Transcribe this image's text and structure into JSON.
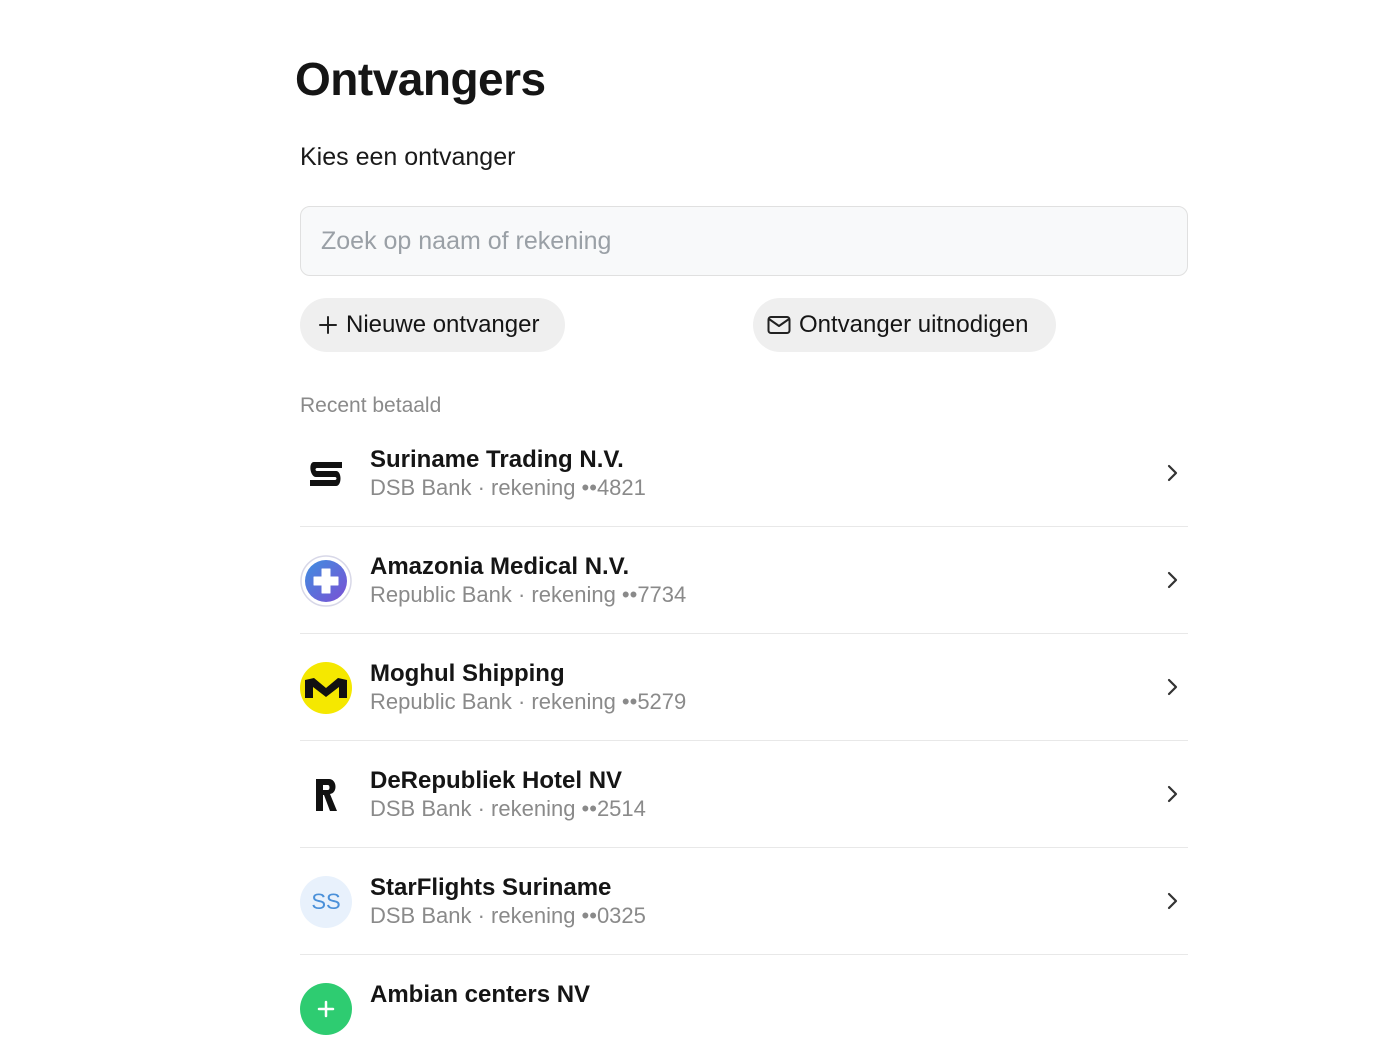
{
  "page": {
    "title": "Ontvangers",
    "subtitle": "Kies een ontvanger"
  },
  "search": {
    "placeholder": "Zoek op naam of rekening",
    "value": ""
  },
  "actions": {
    "new_label": "Nieuwe ontvanger",
    "new_icon": "plus-icon",
    "invite_label": "Ontvanger uitnodigen",
    "invite_icon": "mail-icon"
  },
  "recent": {
    "label": "Recent betaald",
    "items": [
      {
        "name": "Suriname Trading N.V.",
        "meta": "DSB Bank · rekening ••4821",
        "avatar": "s-logo-icon"
      },
      {
        "name": "Amazonia Medical N.V.",
        "meta": "Republic Bank · rekening ••7734",
        "avatar": "medical-cross-icon"
      },
      {
        "name": "Moghul Shipping",
        "meta": "Republic Bank · rekening ••5279",
        "avatar": "m-logo-icon"
      },
      {
        "name": "DeRepubliek Hotel NV",
        "meta": "DSB Bank · rekening ••2514",
        "avatar": "r-logo-icon"
      },
      {
        "name": "StarFlights Suriname",
        "meta": "DSB Bank · rekening ••0325",
        "avatar": "initials",
        "initials": "SS"
      },
      {
        "name": "Ambian centers NV",
        "meta": "",
        "avatar": "green-logo-icon"
      }
    ]
  },
  "colors": {
    "accent_blue": "#4a90d9",
    "medical_ring": "#6a5acd",
    "shipping_yellow": "#f5e800",
    "green_logo": "#2ecc71",
    "muted_text": "#8a8a8a"
  }
}
